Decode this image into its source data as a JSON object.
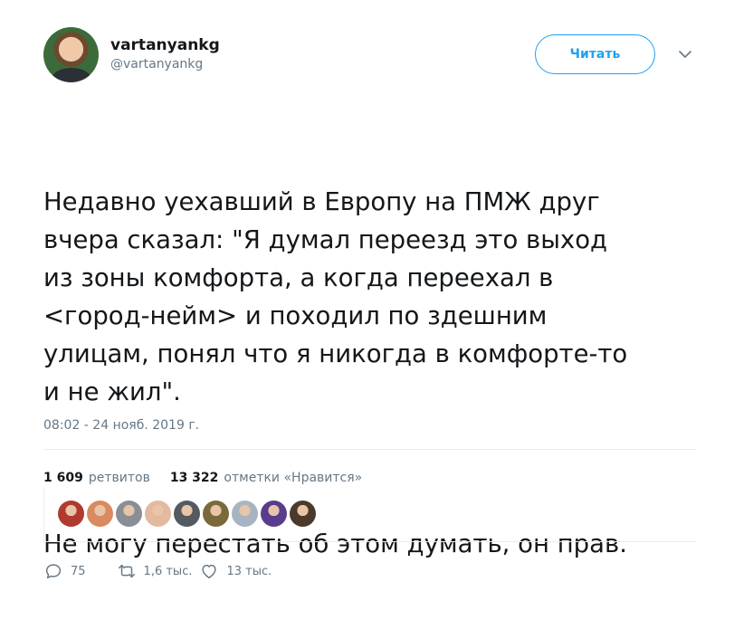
{
  "header": {
    "display_name": "vartanyankg",
    "handle": "@vartanyankg",
    "follow_label": "Читать"
  },
  "tweet": {
    "paragraph1": "Недавно уехавший в Европу на ПМЖ друг\nвчера сказал: \"Я думал переезд это выход\nиз зоны комфорта, а когда переехал в\n<город-нейм> и походил по здешним\nулицам, понял что я никогда в комфорте-то\nи не жил\".",
    "paragraph2": "Не могу перестать об этом думать, он прав.",
    "timestamp": "08:02 - 24 нояб. 2019 г."
  },
  "stats": {
    "retweets_count": "1 609",
    "retweets_label": "ретвитов",
    "likes_count": "13 322",
    "likes_label": "отметки «Нравится»"
  },
  "likers": [
    {
      "name": "liker-1",
      "color": "#b03a2e"
    },
    {
      "name": "liker-2",
      "color": "#d98a5f"
    },
    {
      "name": "liker-3",
      "color": "#8a8f96"
    },
    {
      "name": "liker-4",
      "color": "#e3b9a0"
    },
    {
      "name": "liker-5",
      "color": "#555a60"
    },
    {
      "name": "liker-6",
      "color": "#7a6a3a"
    },
    {
      "name": "liker-7",
      "color": "#a9b4c2"
    },
    {
      "name": "liker-8",
      "color": "#5a3c8c"
    },
    {
      "name": "liker-9",
      "color": "#4b3a2a"
    }
  ],
  "actions": {
    "reply_count": "75",
    "retweet_count": "1,6 тыс.",
    "like_count": "13 тыс."
  },
  "colors": {
    "accent": "#1da1f2",
    "secondary_text": "#657786",
    "divider": "#e6ecf0"
  }
}
